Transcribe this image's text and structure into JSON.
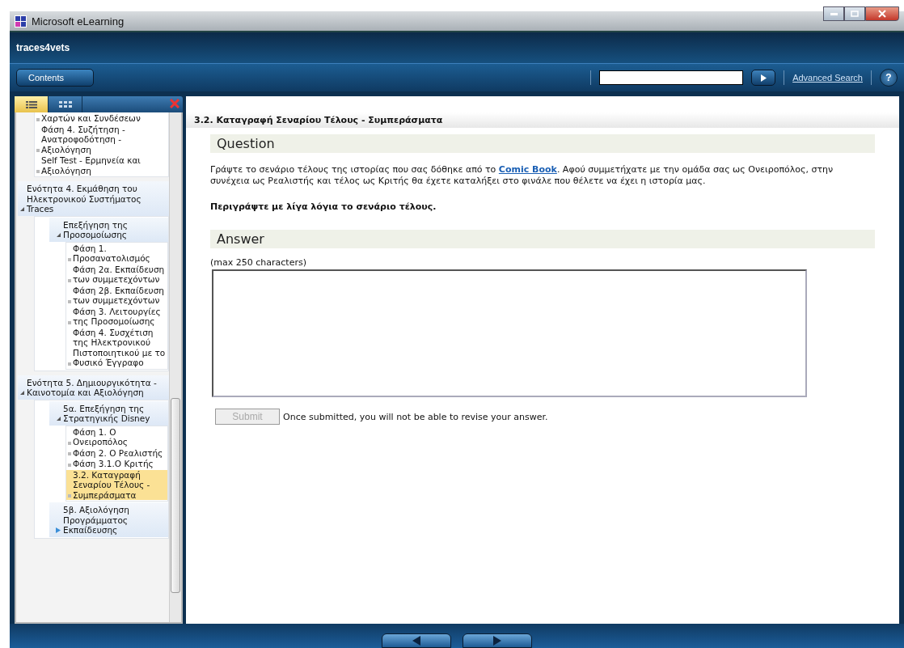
{
  "window": {
    "title": "Microsoft eLearning",
    "app_name": "traces4vets"
  },
  "toolbar": {
    "contents_button": "Contents",
    "advanced_search": "Advanced Search",
    "help": "?"
  },
  "sidebar": {
    "tabs": [
      {
        "kind": "list",
        "selected": true
      },
      {
        "kind": "grid",
        "selected": false
      }
    ],
    "tree": [
      {
        "kind": "list",
        "children": [
          {
            "kind": "leaf",
            "label": "Χαρτών και Συνδέσεων",
            "selected": false
          },
          {
            "kind": "leaf",
            "label": "Φάση 4. Συζήτηση - Ανατροφοδότηση - Αξιολόγηση",
            "selected": false
          },
          {
            "kind": "leaf",
            "label": "Self Test - Ερμηνεία και Αξιολόγηση",
            "selected": false
          }
        ]
      },
      {
        "kind": "group",
        "label": "Ενότητα 4. Εκμάθηση του Ηλεκτρονικού Συστήματος Traces",
        "expanded": true,
        "children": [
          {
            "kind": "group",
            "label": "Επεξήγηση της Προσομοίωσης",
            "expanded": true,
            "children": [
              {
                "kind": "leaf",
                "label": "Φάση 1. Προσανατολισμός",
                "selected": false
              },
              {
                "kind": "leaf",
                "label": "Φάση 2α. Εκπαίδευση των συμμετεχόντων",
                "selected": false
              },
              {
                "kind": "leaf",
                "label": "Φάση 2β. Εκπαίδευση των συμμετεχόντων",
                "selected": false
              },
              {
                "kind": "leaf",
                "label": "Φάση 3. Λειτουργίες της Προσομοίωσης",
                "selected": false
              },
              {
                "kind": "leaf",
                "label": "Φάση 4. Συσχέτιση της Ηλεκτρονικού Πιστοποιητικού με το Φυσικό Έγγραφο",
                "selected": false
              }
            ]
          }
        ]
      },
      {
        "kind": "group",
        "label": "Ενότητα 5. Δημιουργικότητα - Καινοτομία και Αξιολόγηση",
        "expanded": true,
        "children": [
          {
            "kind": "group",
            "label": "5α. Επεξήγηση της Στρατηγικής Disney",
            "expanded": true,
            "children": [
              {
                "kind": "leaf",
                "label": "Φάση 1. Ο Ονειροπόλος",
                "selected": false
              },
              {
                "kind": "leaf",
                "label": "Φάση 2. Ο Ρεαλιστής",
                "selected": false
              },
              {
                "kind": "leaf",
                "label": "Φάση 3.1.Ο Κριτής",
                "selected": false
              },
              {
                "kind": "leaf",
                "label": "3.2. Καταγραφή Σεναρίου Τέλους - Συμπεράσματα",
                "selected": true
              }
            ]
          },
          {
            "kind": "group",
            "label": "5β. Αξιολόγηση Προγράμματος Εκπαίδευσης",
            "expanded": false
          }
        ]
      }
    ]
  },
  "page": {
    "title": "3.2. Καταγραφή Σεναρίου Τέλους - Συμπεράσματα",
    "question_heading": "Question",
    "question_text": "Γράψτε το σενάριο τέλους της ιστορίας που σας δόθηκε από το ",
    "question_link": "Comic Book",
    "question_text_after": ". Αφού συμμετήχατε με την ομάδα σας ως Ονειροπόλος, στην συνέχεια ως Ρεαλιστής και τέλος ως Κριτής θα έχετε καταλήξει στο φινάλε που θέλετε να έχει η ιστορία μας.",
    "instruction": "Περιγράψτε με λίγα λόγια το σενάριο τέλους.",
    "answer_heading": "Answer",
    "answer_hint": "(max 250 characters)",
    "submit": {
      "label": "Submit",
      "disabled": true
    },
    "submit_note": "Once submitted, you will not be able to revise your answer."
  }
}
